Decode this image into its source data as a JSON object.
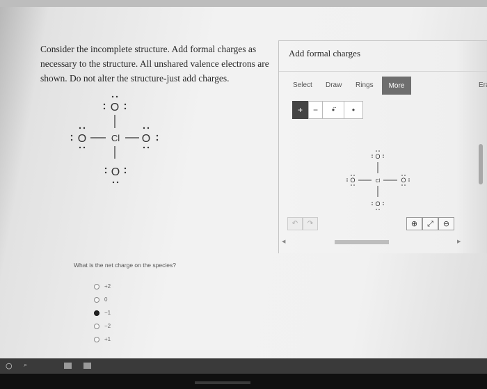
{
  "question": {
    "prompt_lines": [
      "Consider the incomplete structure. Add formal charges as",
      "necessary to the structure. All unshared valence electrons are",
      "shown. Do not alter the structure-just add charges."
    ]
  },
  "structure": {
    "top": "O",
    "left": "O",
    "center": "Cl",
    "right": "O",
    "bottom": "O"
  },
  "panel": {
    "title": "Add formal charges",
    "tabs": [
      "Select",
      "Draw",
      "Rings",
      "More"
    ],
    "active_tab": "More",
    "clipped_tab": "Era",
    "tools": {
      "plus": "+",
      "minus": "−",
      "pair": "•̈",
      "single": "•"
    },
    "canvas_structure": {
      "top": "O",
      "left": "O",
      "center": "Cl",
      "right": "O",
      "bottom": "O"
    },
    "undo_icon": "undo-icon",
    "redo_icon": "redo-icon",
    "zoom_in_icon": "zoom-in-icon",
    "reset_icon": "reset-view-icon",
    "zoom_out_icon": "zoom-out-icon"
  },
  "net_charge": {
    "question": "What is the net charge on the species?",
    "options": [
      "+2",
      "0",
      "−1",
      "−2",
      "+1"
    ],
    "selected": "−1"
  },
  "colors": {
    "active_tab": "#6e6e6e",
    "plus_button": "#444444",
    "selected_radio": "#222222",
    "taskbar": "#3a3a3a"
  }
}
